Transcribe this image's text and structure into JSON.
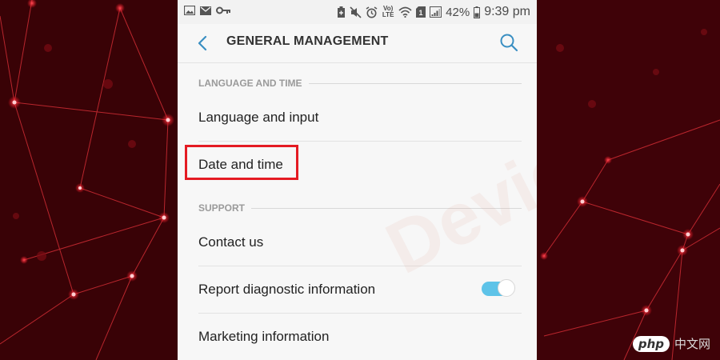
{
  "status_bar": {
    "lte_label": "Vo) LTE",
    "battery": "42%",
    "time": "9:39 pm"
  },
  "header": {
    "title": "GENERAL MANAGEMENT"
  },
  "sections": [
    {
      "title": "LANGUAGE AND TIME",
      "items": [
        "Language and input",
        "Date and time"
      ]
    },
    {
      "title": "SUPPORT",
      "items": [
        "Contact us",
        "Report diagnostic information",
        "Marketing information"
      ]
    }
  ],
  "toggle_state": "on",
  "watermark": {
    "brand": "DeviceTricks",
    "php": "php",
    "cn": "中文网"
  },
  "colors": {
    "accent_blue": "#5ec3e8",
    "highlight_red": "#e41b23",
    "background_dark_red": "#3a0006"
  }
}
